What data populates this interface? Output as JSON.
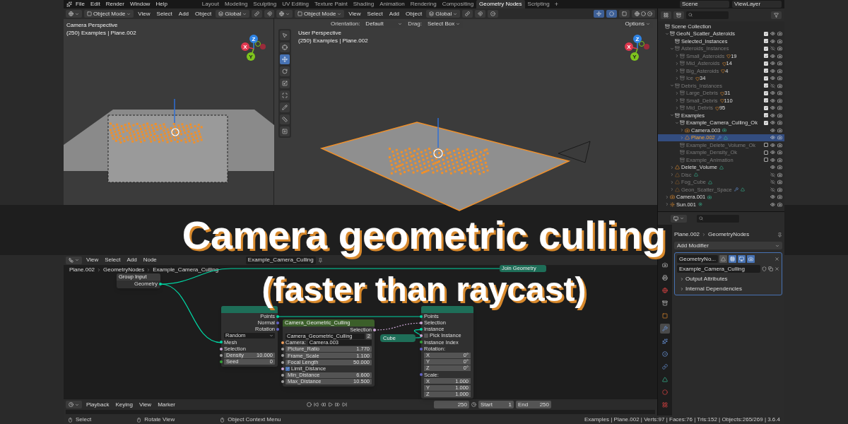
{
  "top_bar": {
    "menus": [
      "File",
      "Edit",
      "Render",
      "Window",
      "Help"
    ],
    "workspaces": [
      {
        "label": "Layout",
        "selected": false
      },
      {
        "label": "Modeling",
        "selected": false
      },
      {
        "label": "Sculpting",
        "selected": false
      },
      {
        "label": "UV Editing",
        "selected": false
      },
      {
        "label": "Texture Paint",
        "selected": false
      },
      {
        "label": "Shading",
        "selected": false
      },
      {
        "label": "Animation",
        "selected": false
      },
      {
        "label": "Rendering",
        "selected": false
      },
      {
        "label": "Compositing",
        "selected": false
      },
      {
        "label": "Geometry Nodes",
        "selected": true
      },
      {
        "label": "Scripting",
        "selected": false
      }
    ],
    "add_tab": "+",
    "scene": "Scene",
    "view_layer": "ViewLayer"
  },
  "viewport_left": {
    "mode": "Object Mode",
    "menus": [
      "View",
      "Select",
      "Add",
      "Object"
    ],
    "orientation": "Global",
    "view_name": "Camera Perspective",
    "context": "(250) Examples | Plane.002",
    "gizmo_axes": [
      "X",
      "Y",
      "Z"
    ]
  },
  "viewport_right": {
    "mode": "Object Mode",
    "menus": [
      "View",
      "Select",
      "Add",
      "Object"
    ],
    "orientation": "Global",
    "orientation_label": "Orientation:",
    "orientation_value": "Default",
    "drag_label": "Drag:",
    "drag_value": "Select Box",
    "options": "Options",
    "view_name": "User Perspective",
    "context": "(250) Examples | Plane.002",
    "gizmo_axes": [
      "X",
      "Y",
      "Z"
    ],
    "tools": [
      {
        "kind": "select",
        "selected": false
      },
      {
        "kind": "cursor",
        "selected": false
      },
      {
        "kind": "move",
        "selected": true
      },
      {
        "kind": "rotate",
        "selected": false
      },
      {
        "kind": "scale",
        "selected": false
      },
      {
        "kind": "transform",
        "selected": false
      },
      {
        "kind": "annotate",
        "selected": false
      },
      {
        "kind": "measure",
        "selected": false
      },
      {
        "kind": "add_cube",
        "selected": false
      }
    ]
  },
  "outliner": {
    "items": [
      {
        "name": "Scene Collection",
        "kind": "collection",
        "selected": false,
        "disabled": false,
        "children": [
          {
            "name": "GeoN_Scatter_Asteroids",
            "kind": "collection",
            "expanded": true,
            "selected": false,
            "disabled": false,
            "checked": true,
            "visible": true,
            "children": [
              {
                "name": "Selected_Instances",
                "kind": "collection",
                "selected": false,
                "disabled": false,
                "checked": true,
                "visible": true
              },
              {
                "name": "Asteroids_Instances",
                "kind": "collection",
                "expanded": true,
                "selected": false,
                "disabled": true,
                "checked": true,
                "visible": false,
                "children": [
                  {
                    "name": "Small_Asteroids",
                    "kind": "collection",
                    "expanded": false,
                    "selected": false,
                    "disabled": true,
                    "checked": true,
                    "visible": true,
                    "count": "19"
                  },
                  {
                    "name": "Mid_Asteroids",
                    "kind": "collection",
                    "expanded": false,
                    "selected": false,
                    "disabled": true,
                    "checked": true,
                    "visible": true,
                    "count": "14"
                  },
                  {
                    "name": "Big_Asteroids",
                    "kind": "collection",
                    "expanded": false,
                    "selected": false,
                    "disabled": true,
                    "checked": true,
                    "visible": true,
                    "count": "4"
                  },
                  {
                    "name": "Ice",
                    "kind": "collection",
                    "expanded": false,
                    "selected": false,
                    "disabled": true,
                    "checked": true,
                    "visible": true,
                    "count": "34"
                  }
                ]
              },
              {
                "name": "Debris_Instances",
                "kind": "collection",
                "expanded": true,
                "selected": false,
                "disabled": true,
                "checked": true,
                "visible": false,
                "children": [
                  {
                    "name": "Large_Debris",
                    "kind": "collection",
                    "expanded": false,
                    "selected": false,
                    "disabled": true,
                    "checked": true,
                    "visible": true,
                    "count": "31"
                  },
                  {
                    "name": "Small_Debris",
                    "kind": "collection",
                    "expanded": false,
                    "selected": false,
                    "disabled": true,
                    "checked": true,
                    "visible": true,
                    "count": "110"
                  },
                  {
                    "name": "Mid_Debris",
                    "kind": "collection",
                    "expanded": false,
                    "selected": false,
                    "disabled": true,
                    "checked": true,
                    "visible": true,
                    "count": "95"
                  }
                ]
              },
              {
                "name": "Examples",
                "kind": "collection",
                "expanded": true,
                "selected": false,
                "disabled": false,
                "checked": true,
                "visible": true,
                "children": [
                  {
                    "name": "Example_Camera_Culling_Ok",
                    "kind": "collection",
                    "expanded": true,
                    "selected": false,
                    "disabled": false,
                    "checked": true,
                    "visible": true,
                    "children": [
                      {
                        "name": "Camera.003",
                        "kind": "camera",
                        "expanded": false,
                        "selected": false,
                        "disabled": false,
                        "visible": true
                      },
                      {
                        "name": "Plane.002",
                        "kind": "mesh",
                        "expanded": false,
                        "selected": true,
                        "disabled": false,
                        "visible": true,
                        "has_modifier": true
                      }
                    ]
                  },
                  {
                    "name": "Example_Delete_Volume_Ok",
                    "kind": "collection",
                    "selected": false,
                    "disabled": true,
                    "checked": false,
                    "visible": true
                  },
                  {
                    "name": "Example_Density_Ok",
                    "kind": "collection",
                    "selected": false,
                    "disabled": true,
                    "checked": false,
                    "visible": true
                  },
                  {
                    "name": "Example_Animation",
                    "kind": "collection",
                    "selected": false,
                    "disabled": true,
                    "checked": false,
                    "visible": true
                  }
                ]
              },
              {
                "name": "Delete_Volume",
                "kind": "mesh",
                "expanded": false,
                "selected": false,
                "disabled": false,
                "visible": true
              },
              {
                "name": "Disc",
                "kind": "mesh",
                "expanded": false,
                "selected": false,
                "disabled": true,
                "visible": false
              },
              {
                "name": "Fog_Cube",
                "kind": "mesh",
                "expanded": false,
                "selected": false,
                "disabled": true,
                "visible": false
              },
              {
                "name": "Geon_Scatter_Space",
                "kind": "mesh",
                "expanded": false,
                "selected": false,
                "disabled": true,
                "visible": false,
                "has_modifier": true
              }
            ]
          },
          {
            "name": "Camera.001",
            "kind": "camera",
            "expanded": false,
            "selected": false,
            "disabled": false,
            "visible": true
          },
          {
            "name": "Sun.001",
            "kind": "light",
            "expanded": false,
            "selected": false,
            "disabled": false,
            "visible": true
          }
        ]
      }
    ]
  },
  "properties": {
    "breadcrumbs": [
      "Plane.002",
      "GeometryNodes"
    ],
    "add_modifier": "Add Modifier",
    "tabs": [
      {
        "kind": "render",
        "selected": false
      },
      {
        "kind": "output",
        "selected": false
      },
      {
        "kind": "world",
        "selected": false
      },
      {
        "kind": "collection",
        "selected": false
      },
      {
        "kind": "object",
        "selected": false
      },
      {
        "kind": "modifier",
        "selected": true
      },
      {
        "kind": "particles",
        "selected": false
      },
      {
        "kind": "physics",
        "selected": false
      },
      {
        "kind": "constraints",
        "selected": false
      },
      {
        "kind": "data",
        "selected": false
      },
      {
        "kind": "material",
        "selected": false
      },
      {
        "kind": "texture",
        "selected": false
      }
    ],
    "modifier": {
      "name": "GeometryNo...",
      "toggles": [
        {
          "kind": "on_cage",
          "on": false
        },
        {
          "kind": "edit_mode",
          "on": true
        },
        {
          "kind": "viewport",
          "on": true
        },
        {
          "kind": "render",
          "on": true
        }
      ],
      "node_group": "Example_Camera_Culling",
      "panels": [
        {
          "label": "Output Attributes",
          "expanded": false
        },
        {
          "label": "Internal Dependencies",
          "expanded": false
        }
      ]
    }
  },
  "node_editor": {
    "menus": [
      "View",
      "Select",
      "Add",
      "Node"
    ],
    "node_group": "Example_Camera_Culling",
    "breadcrumbs": [
      "Plane.002",
      "GeometryNodes",
      "Example_Camera_Culling"
    ],
    "nodes": [
      {
        "kind": "input",
        "title": "Group Input",
        "rows": [
          {
            "kind": "output",
            "label": "Geometry",
            "color": "#00d6a3"
          }
        ]
      },
      {
        "kind": "geometry",
        "rows": [
          {
            "kind": "output",
            "label": "Points",
            "color": "#00d6a3"
          },
          {
            "kind": "output",
            "label": "Normal",
            "color": "#6363c7"
          },
          {
            "kind": "output",
            "label": "Rotation",
            "color": "#6363c7"
          },
          {
            "kind": "dropdown",
            "value": "Random"
          },
          {
            "kind": "input",
            "label": "Mesh",
            "color": "#00d6a3"
          },
          {
            "kind": "input",
            "label": "Selection",
            "color": "#cca6d6"
          },
          {
            "kind": "field",
            "label": "Density",
            "value": "10.000",
            "color": "#a1a1a1"
          },
          {
            "kind": "field",
            "label": "Seed",
            "value": "0",
            "color": "#35a33b"
          }
        ]
      },
      {
        "kind": "group",
        "title": "Camera_Geometric_Culling",
        "rows": [
          {
            "kind": "output",
            "label": "Selection",
            "color": "#cca6d6"
          },
          {
            "kind": "group_selector",
            "value": "Camera_Geometric_Culling",
            "users": "2"
          },
          {
            "kind": "object",
            "label": "Camera:",
            "value": "Camera.003",
            "color": "#ed9e5c"
          },
          {
            "kind": "field",
            "label": "Picture_Ratio",
            "value": "1.770",
            "color": "#a1a1a1"
          },
          {
            "kind": "field",
            "label": "Frame_Scale",
            "value": "1.100",
            "color": "#a1a1a1"
          },
          {
            "kind": "field",
            "label": "Focal Length",
            "value": "50.000",
            "color": "#a1a1a1"
          },
          {
            "kind": "checkbox",
            "label": "Limit_Distance",
            "checked": true,
            "color": "#cca6d6"
          },
          {
            "kind": "field",
            "label": "Min_Distance",
            "value": "6.600",
            "color": "#a1a1a1"
          },
          {
            "kind": "field",
            "label": "Max_Distance",
            "value": "10.500",
            "color": "#a1a1a1"
          }
        ]
      },
      {
        "kind": "collapsed",
        "title": "Cube"
      },
      {
        "kind": "geometry",
        "rows": [
          {
            "kind": "input",
            "label": "Points",
            "color": "#00d6a3"
          },
          {
            "kind": "input",
            "label": "Selection",
            "color": "#cca6d6"
          },
          {
            "kind": "input",
            "label": "Instance",
            "color": "#00d6a3"
          },
          {
            "kind": "checkbox",
            "label": "Pick Instance",
            "checked": false,
            "color": "#cca6d6"
          },
          {
            "kind": "input",
            "label": "Instance Index",
            "color": "#35a33b"
          },
          {
            "kind": "heading",
            "label": "Rotation:",
            "color": "#6363c7"
          },
          {
            "kind": "vector",
            "label": "X",
            "value": "0°"
          },
          {
            "kind": "vector",
            "label": "Y",
            "value": "0°"
          },
          {
            "kind": "vector",
            "label": "Z",
            "value": "0°"
          },
          {
            "kind": "heading",
            "label": "Scale:",
            "color": "#6363c7"
          },
          {
            "kind": "vector",
            "label": "X",
            "value": "1.000"
          },
          {
            "kind": "vector",
            "label": "Y",
            "value": "1.000"
          },
          {
            "kind": "vector",
            "label": "Z",
            "value": "1.000"
          }
        ]
      },
      {
        "kind": "geometry",
        "title": "Join Geometry"
      }
    ]
  },
  "timeline": {
    "menus": [
      "Playback",
      "Keying",
      "View",
      "Marker"
    ],
    "current_frame": "250",
    "start_label": "Start",
    "start": "1",
    "end_label": "End",
    "end": "250"
  },
  "status_bar": {
    "hints": [
      "Select",
      "Rotate View",
      "Object Context Menu"
    ],
    "stats": "Examples | Plane.002 | Verts:97 | Faces:76 | Tris:152 | Objects:265/269 | 3.6.4"
  },
  "overlay_title": [
    "Camera geometric culling",
    "(faster than raycast)"
  ]
}
